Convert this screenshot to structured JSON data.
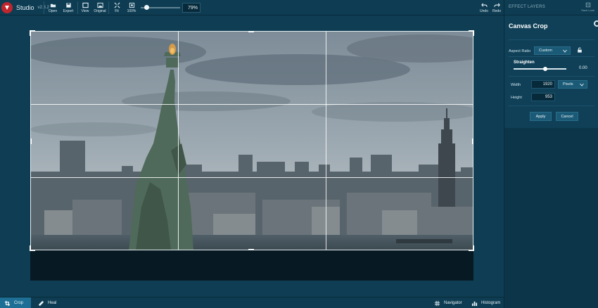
{
  "app": {
    "name": "Studio",
    "version": "v2.3.2"
  },
  "toolbar": {
    "open": "Open",
    "export": "Export",
    "view": "View",
    "original": "Original",
    "fit": "Fit",
    "zoom100": "100%",
    "zoom_value": "79%",
    "undo": "Undo",
    "redo": "Redo"
  },
  "panel": {
    "tab": "EFFECT LAYERS",
    "save_look": "Save Look",
    "title": "Canvas Crop",
    "aspect_label": "Aspect Ratio",
    "aspect_value": "Custom",
    "straighten_label": "Straighten",
    "straighten_value": "0.00",
    "width_label": "Width",
    "width_value": "1920",
    "unit_value": "Pixels",
    "height_label": "Height",
    "height_value": "953",
    "apply": "Apply",
    "cancel": "Cancel"
  },
  "bottom": {
    "crop": "Crop",
    "heal": "Heal",
    "navigator": "Navigator",
    "histogram": "Histogram"
  },
  "colors": {
    "accent": "#1d6f95",
    "brand": "#c0262d",
    "panel": "#0c3549"
  }
}
